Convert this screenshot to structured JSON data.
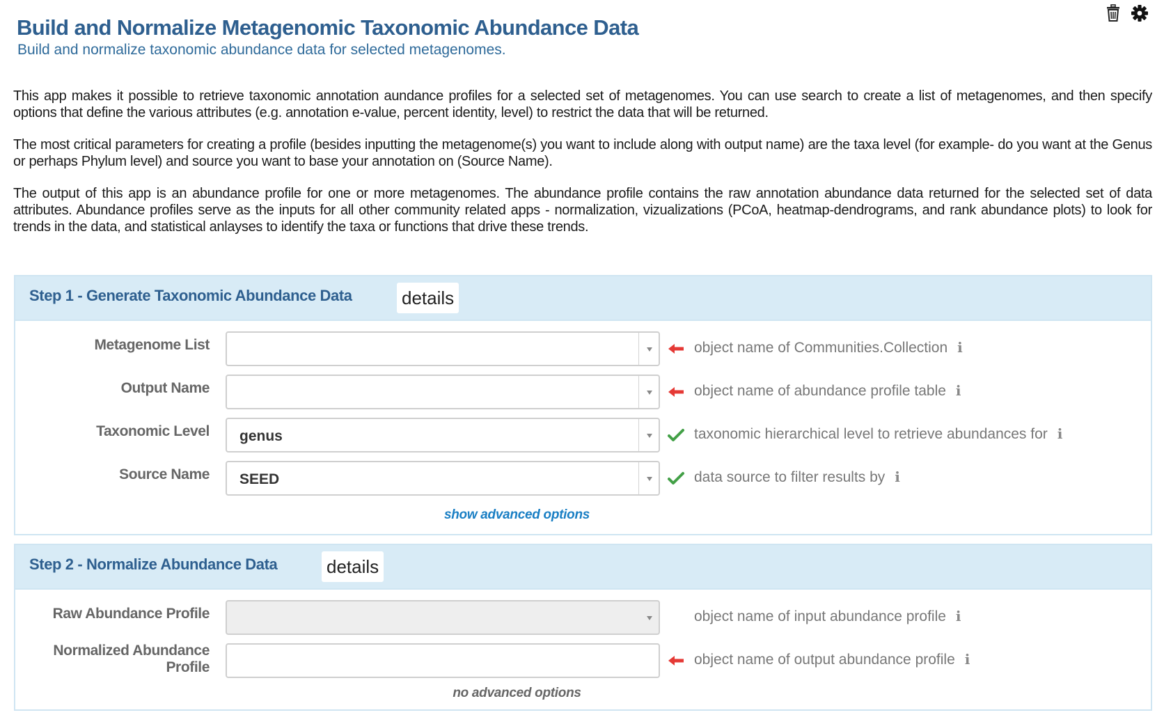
{
  "header": {
    "title": "Build and Normalize Metagenomic Taxonomic Abundance Data",
    "subtitle": "Build and normalize taxonomic abundance data for selected metagenomes.",
    "icons": [
      "trash-icon",
      "gear-icon"
    ]
  },
  "description": {
    "p1": "This app makes it possible to retrieve taxonomic annotation aundance profiles for a selected set of metagenomes. You can use search to create a list of metagenomes, and then specify options that define the various attributes (e.g. annotation e-value, percent identity, level) to restrict the data that will be returned.",
    "p2": "The most critical parameters for creating a profile (besides inputting the metagenome(s) you want to include along with output name) are the taxa level (for example- do you want at the Genus or perhaps Phylum level) and source you want to base your annotation on (Source Name).",
    "p3": "The output of this app is an abundance profile for one or more metagenomes. The abundance profile contains the raw annotation abundance data returned for the selected set of data attributes. Abundance profiles serve as the inputs for all other community related apps - normalization, vizualizations (PCoA, heatmap-dendrograms, and rank abundance plots) to look for trends in the data, and statistical anlayses to identify the taxa or functions that drive these trends."
  },
  "step1": {
    "title": "Step 1  -  Generate Taxonomic Abundance Data",
    "details_label": "details",
    "fields": [
      {
        "label": "Metagenome List",
        "value": "",
        "hint": "object name of Communities.Collection",
        "status": "required"
      },
      {
        "label": "Output Name",
        "value": "",
        "hint": "object name of abundance profile table",
        "status": "required"
      },
      {
        "label": "Taxonomic Level",
        "value": "genus",
        "hint": "taxonomic hierarchical level to retrieve abundances for",
        "status": "valid"
      },
      {
        "label": "Source Name",
        "value": "SEED",
        "hint": "data source to filter results by",
        "status": "valid"
      }
    ],
    "advanced_label": "show advanced options"
  },
  "step2": {
    "title": "Step 2  -  Normalize Abundance Data",
    "details_label": "details",
    "fields": [
      {
        "label": "Raw Abundance Profile",
        "value": "",
        "hint": "object name of input abundance profile",
        "status": "none"
      },
      {
        "label": "Normalized Abundance Profile",
        "value": "",
        "hint": "object name of output abundance profile",
        "status": "required"
      }
    ],
    "advanced_label": "no advanced options"
  },
  "info_glyph": "i",
  "colors": {
    "title": "#2e5f8f",
    "header_bg": "#d8ebf6",
    "arrow": "#e53935",
    "check": "#43a047",
    "link": "#1a7fc4"
  }
}
